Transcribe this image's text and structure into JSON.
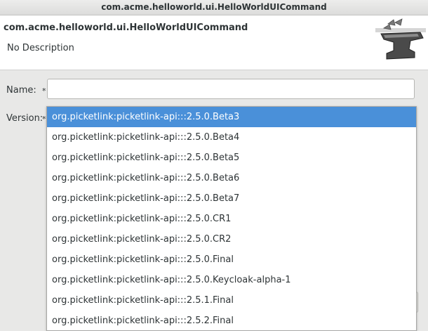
{
  "window": {
    "title": "com.acme.helloworld.ui.HelloWorldUICommand"
  },
  "header": {
    "title": "com.acme.helloworld.ui.HelloWorldUICommand",
    "description": "No Description",
    "logo_icon": "anvil-icon"
  },
  "form": {
    "name_label": "Name:",
    "name_required": "*",
    "name_value": "",
    "version_label": "Version:",
    "version_required": "*"
  },
  "version_dropdown": {
    "selected_index": 0,
    "options": [
      "org.picketlink:picketlink-api:::2.5.0.Beta3",
      "org.picketlink:picketlink-api:::2.5.0.Beta4",
      "org.picketlink:picketlink-api:::2.5.0.Beta5",
      "org.picketlink:picketlink-api:::2.5.0.Beta6",
      "org.picketlink:picketlink-api:::2.5.0.Beta7",
      "org.picketlink:picketlink-api:::2.5.0.CR1",
      "org.picketlink:picketlink-api:::2.5.0.CR2",
      "org.picketlink:picketlink-api:::2.5.0.Final",
      "org.picketlink:picketlink-api:::2.5.0.Keycloak-alpha-1",
      "org.picketlink:picketlink-api:::2.5.1.Final",
      "org.picketlink:picketlink-api:::2.5.2.Final"
    ]
  },
  "colors": {
    "selection": "#4a90d9",
    "header_bg": "#ffffff",
    "window_bg": "#e8e8e7"
  }
}
